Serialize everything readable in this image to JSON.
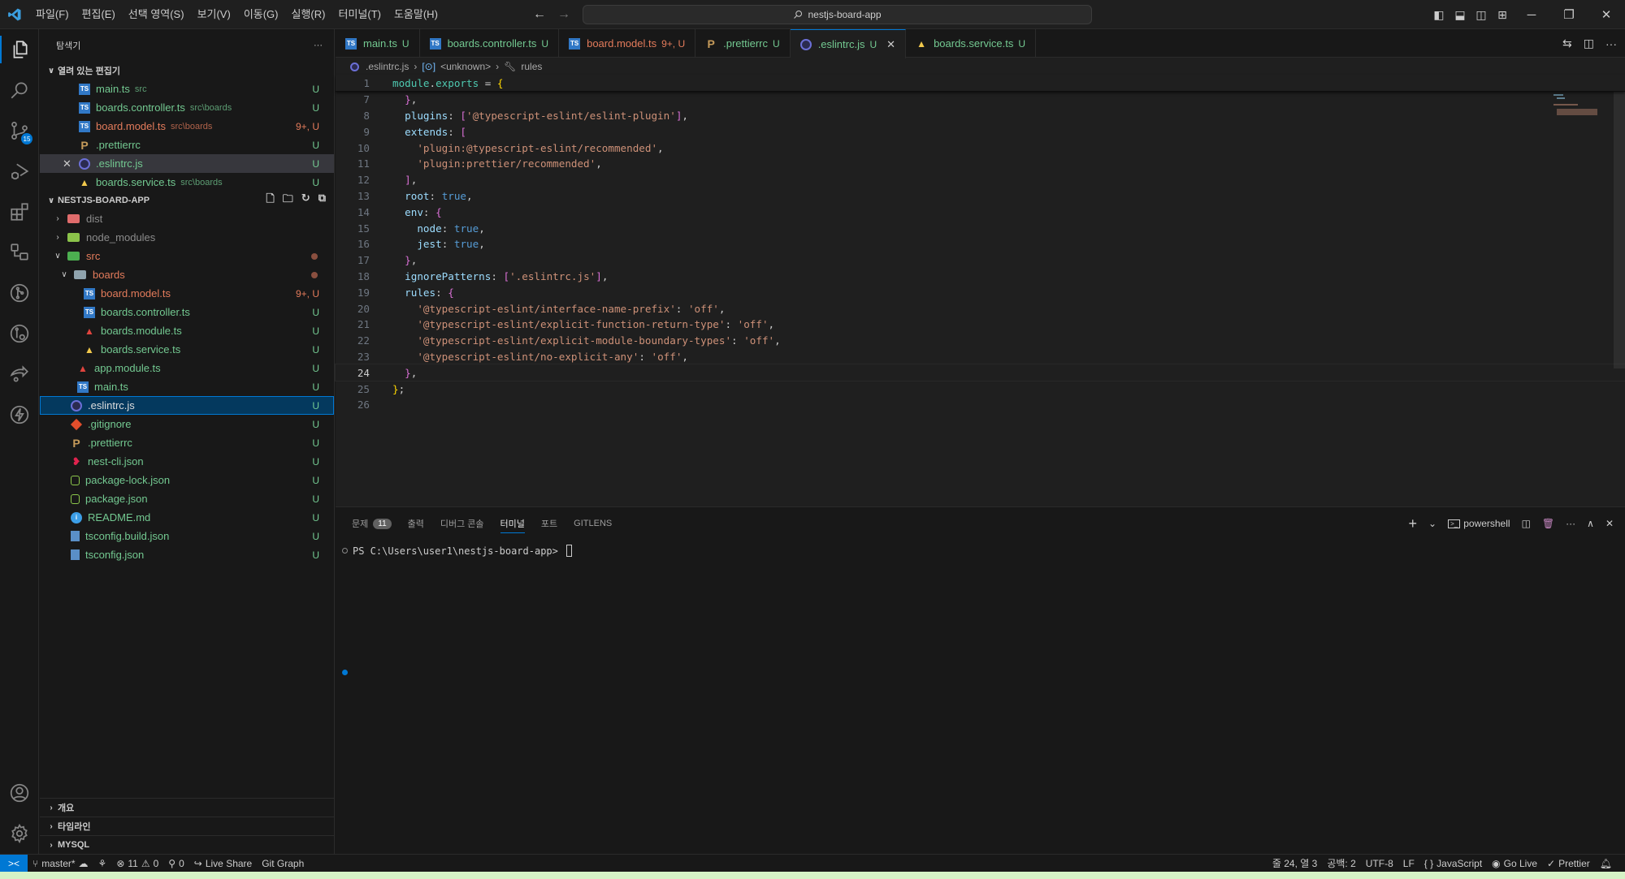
{
  "titlebar": {
    "menu": [
      "파일(F)",
      "편집(E)",
      "선택 영역(S)",
      "보기(V)",
      "이동(G)",
      "실행(R)",
      "터미널(T)",
      "도움말(H)"
    ],
    "search_text": "nestjs-board-app",
    "back": "←",
    "forward": "→",
    "window_controls": {
      "minimize": "─",
      "restore": "❐",
      "close": "✕"
    }
  },
  "activity_bar": {
    "items": [
      {
        "name": "explorer",
        "active": true
      },
      {
        "name": "search"
      },
      {
        "name": "source-control",
        "badge": "15"
      },
      {
        "name": "run-debug"
      },
      {
        "name": "extensions"
      },
      {
        "name": "remote-explorer"
      },
      {
        "name": "gitlens"
      },
      {
        "name": "gitlens-inspect"
      },
      {
        "name": "live-share"
      },
      {
        "name": "thunder-client"
      }
    ],
    "bottom": [
      "accounts",
      "manage"
    ]
  },
  "sidebar": {
    "title": "탐색기",
    "more": "···",
    "open_editors": {
      "title": "열려 있는 편집기",
      "items": [
        {
          "name": "main.ts",
          "desc": "src",
          "status": "U",
          "color": "green",
          "icon": "ts"
        },
        {
          "name": "boards.controller.ts",
          "desc": "src\\boards",
          "status": "U",
          "color": "green",
          "icon": "ts"
        },
        {
          "name": "board.model.ts",
          "desc": "src\\boards",
          "status": "9+, U",
          "color": "red",
          "icon": "ts"
        },
        {
          "name": ".prettierrc",
          "desc": "",
          "status": "U",
          "color": "green",
          "icon": "prettier"
        },
        {
          "name": ".eslintrc.js",
          "desc": "",
          "status": "U",
          "color": "green",
          "icon": "eslint",
          "selected": true,
          "close": "✕"
        },
        {
          "name": "boards.service.ts",
          "desc": "src\\boards",
          "status": "U",
          "color": "green",
          "icon": "angular-yellow"
        }
      ]
    },
    "project": {
      "title": "NESTJS-BOARD-APP",
      "tree": [
        {
          "name": "dist",
          "depth": 0,
          "type": "folder",
          "chevron": ">",
          "color": "dim",
          "icon_color": "#e06c6c"
        },
        {
          "name": "node_modules",
          "depth": 0,
          "type": "folder",
          "chevron": ">",
          "color": "dim",
          "icon_color": "#8bc34a"
        },
        {
          "name": "src",
          "depth": 0,
          "type": "folder",
          "chevron": "v",
          "color": "red",
          "icon_color": "#4caf50",
          "dot": true
        },
        {
          "name": "boards",
          "depth": 1,
          "type": "folder",
          "chevron": "v",
          "color": "red",
          "icon_color": "#90a4ae",
          "dot": true
        },
        {
          "name": "board.model.ts",
          "depth": 2,
          "icon": "ts",
          "color": "red",
          "status": "9+, U"
        },
        {
          "name": "boards.controller.ts",
          "depth": 2,
          "icon": "ts",
          "color": "green",
          "status": "U"
        },
        {
          "name": "boards.module.ts",
          "depth": 2,
          "icon": "angular-red",
          "color": "green",
          "status": "U"
        },
        {
          "name": "boards.service.ts",
          "depth": 2,
          "icon": "angular-yellow",
          "color": "green",
          "status": "U"
        },
        {
          "name": "app.module.ts",
          "depth": 1,
          "icon": "angular-red",
          "color": "green",
          "status": "U"
        },
        {
          "name": "main.ts",
          "depth": 1,
          "icon": "ts",
          "color": "green",
          "status": "U"
        },
        {
          "name": ".eslintrc.js",
          "depth": 0,
          "icon": "eslint",
          "color": "white",
          "status": "U",
          "focused": true
        },
        {
          "name": ".gitignore",
          "depth": 0,
          "icon": "git",
          "color": "green",
          "status": "U"
        },
        {
          "name": ".prettierrc",
          "depth": 0,
          "icon": "prettier",
          "color": "green",
          "status": "U"
        },
        {
          "name": "nest-cli.json",
          "depth": 0,
          "icon": "nest",
          "color": "green",
          "status": "U"
        },
        {
          "name": "package-lock.json",
          "depth": 0,
          "icon": "npm",
          "color": "green",
          "status": "U"
        },
        {
          "name": "package.json",
          "depth": 0,
          "icon": "npm",
          "color": "green",
          "status": "U"
        },
        {
          "name": "README.md",
          "depth": 0,
          "icon": "info",
          "color": "green",
          "status": "U"
        },
        {
          "name": "tsconfig.build.json",
          "depth": 0,
          "icon": "tsconfig",
          "color": "green",
          "status": "U"
        },
        {
          "name": "tsconfig.json",
          "depth": 0,
          "icon": "tsconfig",
          "color": "green",
          "status": "U"
        }
      ]
    },
    "bottom_sections": [
      "개요",
      "타임라인",
      "MYSQL"
    ]
  },
  "editor": {
    "tabs": [
      {
        "name": "main.ts",
        "status": "U",
        "color": "green",
        "icon": "ts"
      },
      {
        "name": "boards.controller.ts",
        "status": "U",
        "color": "green",
        "icon": "ts"
      },
      {
        "name": "board.model.ts",
        "status": "9+, U",
        "color": "red",
        "icon": "ts"
      },
      {
        "name": ".prettierrc",
        "status": "U",
        "color": "green",
        "icon": "prettier"
      },
      {
        "name": ".eslintrc.js",
        "status": "U",
        "color": "green",
        "icon": "eslint",
        "active": true,
        "close": "✕"
      },
      {
        "name": "boards.service.ts",
        "status": "U",
        "color": "green",
        "icon": "angular-yellow"
      }
    ],
    "breadcrumbs": [
      ".eslintrc.js",
      "<unknown>",
      "rules"
    ],
    "current_line": 24,
    "lines": [
      {
        "n": "1",
        "sticky": true,
        "html": "<span class='f'>module</span><span class='w'>.</span><span class='f'>exports</span><span class='w'> = </span><span class='p1'>{</span>"
      },
      {
        "n": "7",
        "html": "  <span class='p2'>}</span><span class='w'>,</span>"
      },
      {
        "n": "8",
        "html": "  <span class='k'>plugins</span><span class='w'>: </span><span class='p2'>[</span><span class='s'>'@typescript-eslint/eslint-plugin'</span><span class='p2'>]</span><span class='w'>,</span>"
      },
      {
        "n": "9",
        "html": "  <span class='k'>extends</span><span class='w'>: </span><span class='p2'>[</span>"
      },
      {
        "n": "10",
        "html": "    <span class='s'>'plugin:@typescript-eslint/recommended'</span><span class='w'>,</span>"
      },
      {
        "n": "11",
        "html": "    <span class='s'>'plugin:prettier/recommended'</span><span class='w'>,</span>"
      },
      {
        "n": "12",
        "html": "  <span class='p2'>]</span><span class='w'>,</span>"
      },
      {
        "n": "13",
        "html": "  <span class='k'>root</span><span class='w'>: </span><span class='b'>true</span><span class='w'>,</span>"
      },
      {
        "n": "14",
        "html": "  <span class='k'>env</span><span class='w'>: </span><span class='p2'>{</span>"
      },
      {
        "n": "15",
        "html": "    <span class='k'>node</span><span class='w'>: </span><span class='b'>true</span><span class='w'>,</span>"
      },
      {
        "n": "16",
        "html": "    <span class='k'>jest</span><span class='w'>: </span><span class='b'>true</span><span class='w'>,</span>"
      },
      {
        "n": "17",
        "html": "  <span class='p2'>}</span><span class='w'>,</span>"
      },
      {
        "n": "18",
        "html": "  <span class='k'>ignorePatterns</span><span class='w'>: </span><span class='p2'>[</span><span class='s'>'.eslintrc.js'</span><span class='p2'>]</span><span class='w'>,</span>"
      },
      {
        "n": "19",
        "html": "  <span class='k'>rules</span><span class='w'>: </span><span class='p2'>{</span>"
      },
      {
        "n": "20",
        "html": "    <span class='s'>'@typescript-eslint/interface-name-prefix'</span><span class='w'>: </span><span class='s'>'off'</span><span class='w'>,</span>"
      },
      {
        "n": "21",
        "html": "    <span class='s'>'@typescript-eslint/explicit-function-return-type'</span><span class='w'>: </span><span class='s'>'off'</span><span class='w'>,</span>"
      },
      {
        "n": "22",
        "html": "    <span class='s'>'@typescript-eslint/explicit-module-boundary-types'</span><span class='w'>: </span><span class='s'>'off'</span><span class='w'>,</span>"
      },
      {
        "n": "23",
        "html": "    <span class='s'>'@typescript-eslint/no-explicit-any'</span><span class='w'>: </span><span class='s'>'off'</span><span class='w'>,</span>"
      },
      {
        "n": "24",
        "html": "  <span class='p2'>}</span><span class='w'>,</span>"
      },
      {
        "n": "25",
        "html": "<span class='p1'>}</span><span class='w'>;</span>"
      },
      {
        "n": "26",
        "html": ""
      }
    ]
  },
  "panel": {
    "tabs": [
      {
        "label": "문제",
        "badge": "11"
      },
      {
        "label": "출력"
      },
      {
        "label": "디버그 콘솔"
      },
      {
        "label": "터미널",
        "active": true
      },
      {
        "label": "포트"
      },
      {
        "label": "GITLENS"
      }
    ],
    "shell": "powershell",
    "prompt": "PS C:\\Users\\user1\\nestjs-board-app>"
  },
  "statusbar": {
    "left": {
      "branch": "master*",
      "errors": "11",
      "warnings": "0",
      "ports": "0",
      "live_share": "Live Share",
      "git_graph": "Git Graph"
    },
    "right": {
      "position": "줄 24, 열 3",
      "spaces": "공백: 2",
      "encoding": "UTF-8",
      "eol": "LF",
      "language": "JavaScript",
      "go_live": "Go Live",
      "prettier": "Prettier"
    }
  }
}
